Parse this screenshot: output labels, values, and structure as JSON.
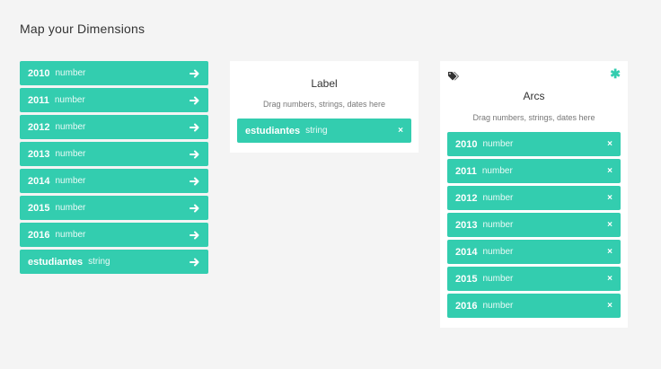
{
  "heading": "Map your Dimensions",
  "dimensions": [
    {
      "name": "2010",
      "type": "number"
    },
    {
      "name": "2011",
      "type": "number"
    },
    {
      "name": "2012",
      "type": "number"
    },
    {
      "name": "2013",
      "type": "number"
    },
    {
      "name": "2014",
      "type": "number"
    },
    {
      "name": "2015",
      "type": "number"
    },
    {
      "name": "2016",
      "type": "number"
    },
    {
      "name": "estudiantes",
      "type": "string"
    }
  ],
  "label_card": {
    "title": "Label",
    "hint": "Drag numbers, strings, dates here",
    "items": [
      {
        "name": "estudiantes",
        "type": "string",
        "close": "×"
      }
    ]
  },
  "arcs_card": {
    "title": "Arcs",
    "hint": "Drag numbers, strings, dates here",
    "required_marker": "✱",
    "items": [
      {
        "name": "2010",
        "type": "number",
        "close": "×"
      },
      {
        "name": "2011",
        "type": "number",
        "close": "×"
      },
      {
        "name": "2012",
        "type": "number",
        "close": "×"
      },
      {
        "name": "2013",
        "type": "number",
        "close": "×"
      },
      {
        "name": "2014",
        "type": "number",
        "close": "×"
      },
      {
        "name": "2015",
        "type": "number",
        "close": "×"
      },
      {
        "name": "2016",
        "type": "number",
        "close": "×"
      }
    ]
  },
  "colors": {
    "accent": "#33cdaf",
    "background": "#f4f4f4",
    "card": "#ffffff"
  },
  "icons": {
    "dimension_action": "arrow-right-icon",
    "card_type": "tags-icon",
    "required": "asterisk-icon",
    "remove": "close-icon"
  }
}
